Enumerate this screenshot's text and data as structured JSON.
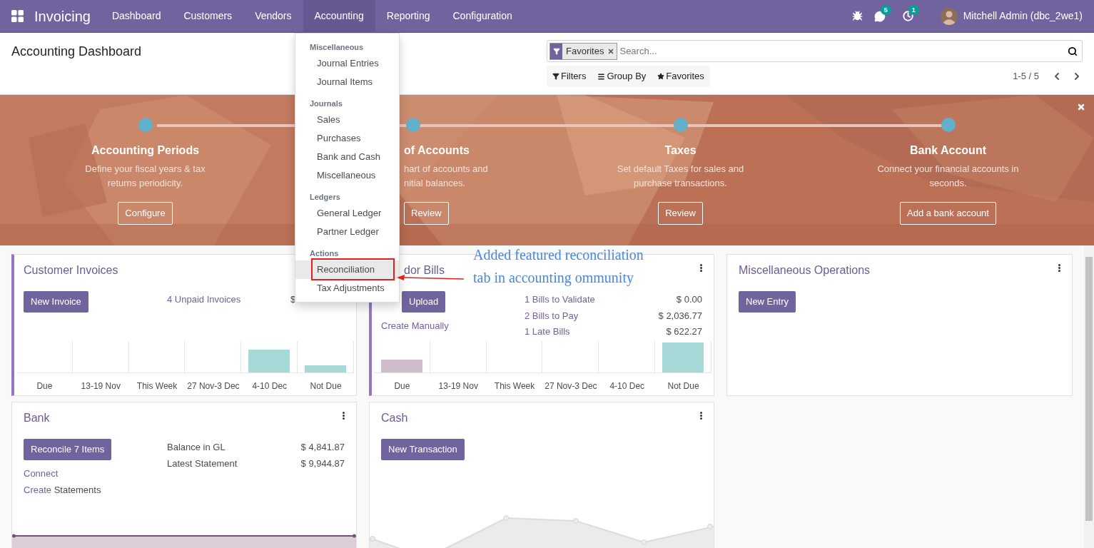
{
  "navbar": {
    "app_name": "Invoicing",
    "menu": [
      {
        "label": "Dashboard",
        "selected": false
      },
      {
        "label": "Customers",
        "selected": false
      },
      {
        "label": "Vendors",
        "selected": false
      },
      {
        "label": "Accounting",
        "selected": true
      },
      {
        "label": "Reporting",
        "selected": false
      },
      {
        "label": "Configuration",
        "selected": false
      }
    ],
    "messages_badge": "5",
    "activities_badge": "1",
    "user": "Mitchell Admin (dbc_2we1)"
  },
  "control_panel": {
    "title": "Accounting Dashboard",
    "search": {
      "facet": "Favorites",
      "placeholder": "Search..."
    },
    "buttons": [
      {
        "kind": "filter",
        "label": "Filters"
      },
      {
        "kind": "group",
        "label": "Group By"
      },
      {
        "kind": "favorite",
        "label": "Favorites"
      }
    ],
    "pager": "1-5 / 5"
  },
  "onboarding": {
    "steps": [
      {
        "kind": "full",
        "title": "Accounting Periods",
        "lines": [
          "Define your fiscal years & tax",
          "returns periodicity."
        ],
        "button": "Configure"
      },
      {
        "kind": "cut",
        "title": "of Accounts",
        "lines": [
          "hart of accounts and",
          "nitial balances."
        ],
        "button": "Review"
      },
      {
        "kind": "full",
        "title": "Taxes",
        "lines": [
          "Set default Taxes for sales and",
          "purchase transactions."
        ],
        "button": "Review"
      },
      {
        "kind": "full",
        "title": "Bank Account",
        "lines": [
          "Connect your financial accounts in",
          "seconds."
        ],
        "button": "Add a bank account"
      }
    ]
  },
  "cards": [
    {
      "kind": "invoices",
      "title": "Customer Invoices",
      "title_cut": false,
      "accent": true,
      "has_menu": false,
      "button": "New Invoice",
      "stats": [
        {
          "label": "4 Unpaid Invoices",
          "amount": "$"
        }
      ],
      "chart_categories": [
        "Due",
        "13-19 Nov",
        "This Week",
        "27 Nov-3 Dec",
        "4-10 Dec",
        "Not Due"
      ]
    },
    {
      "kind": "bills",
      "title": "dor Bills",
      "title_cut": true,
      "accent": true,
      "has_menu": true,
      "button": "Upload",
      "link": "Create Manually",
      "stats": [
        {
          "label": "1 Bills to Validate",
          "amount": "$ 0.00"
        },
        {
          "label": "2 Bills to Pay",
          "amount": "$ 2,036.77"
        },
        {
          "label": "1 Late Bills",
          "amount": "$ 622.27"
        }
      ],
      "chart_categories": [
        "Due",
        "13-19 Nov",
        "This Week",
        "27 Nov-3 Dec",
        "4-10 Dec",
        "Not Due"
      ]
    },
    {
      "kind": "misc",
      "title": "Miscellaneous Operations",
      "title_cut": false,
      "accent": false,
      "has_menu": true,
      "button": "New Entry"
    },
    {
      "kind": "bank",
      "title": "Bank",
      "title_cut": false,
      "accent": false,
      "has_menu": true,
      "button": "Reconcile 7 Items",
      "link": "Connect",
      "statement_link": "Create",
      "statement_text": "Statements",
      "stats": [
        {
          "label": "Balance in GL",
          "amount": "$ 4,841.87"
        },
        {
          "label": "Latest Statement",
          "amount": "$ 9,944.87"
        }
      ]
    },
    {
      "kind": "cash",
      "title": "Cash",
      "title_cut": false,
      "accent": false,
      "has_menu": true,
      "button": "New Transaction"
    }
  ],
  "dropdown": {
    "sections": [
      {
        "header": "Miscellaneous",
        "items": [
          {
            "label": "Journal Entries",
            "selected": false
          },
          {
            "label": "Journal Items",
            "selected": false
          }
        ]
      },
      {
        "header": "Journals",
        "items": [
          {
            "label": "Sales",
            "selected": false
          },
          {
            "label": "Purchases",
            "selected": false
          },
          {
            "label": "Bank and Cash",
            "selected": false
          },
          {
            "label": "Miscellaneous",
            "selected": false
          }
        ]
      },
      {
        "header": "Ledgers",
        "items": [
          {
            "label": "General Ledger",
            "selected": false
          },
          {
            "label": "Partner Ledger",
            "selected": false
          }
        ]
      },
      {
        "header": "Actions",
        "items": [
          {
            "label": "Reconciliation",
            "selected": true
          },
          {
            "label": "Tax Adjustments",
            "selected": false
          }
        ]
      }
    ]
  },
  "annotation": {
    "lines": [
      "Added featured reconciliation",
      "tab in accounting ommunity"
    ]
  }
}
